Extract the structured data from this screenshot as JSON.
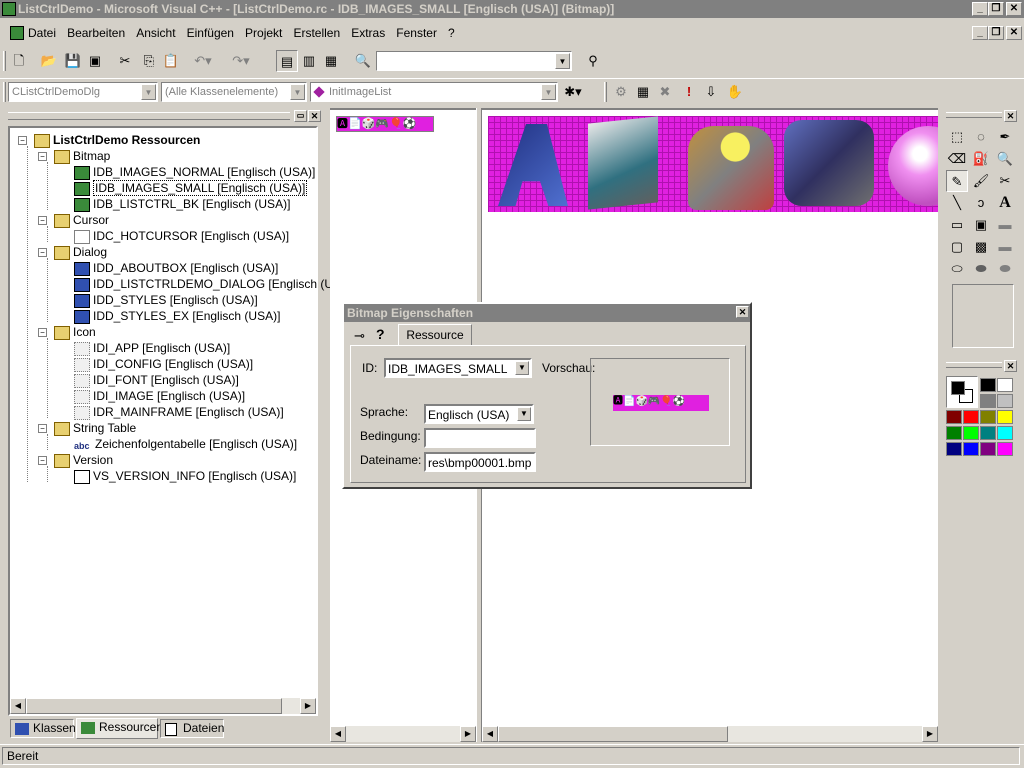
{
  "window": {
    "title": "ListCtrlDemo - Microsoft Visual C++ - [ListCtrlDemo.rc - IDB_IMAGES_SMALL [Englisch (USA)] (Bitmap)]"
  },
  "menu": [
    "Datei",
    "Bearbeiten",
    "Ansicht",
    "Einfügen",
    "Projekt",
    "Erstellen",
    "Extras",
    "Fenster",
    "?"
  ],
  "toolbar": {
    "find_combo_value": "",
    "class_combo": "CListCtrlDemoDlg",
    "members_combo": "(Alle Klassenelemente)",
    "function_combo": "InitImageList"
  },
  "tree": {
    "root": "ListCtrlDemo Ressourcen",
    "folders": {
      "bitmap": "Bitmap",
      "cursor": "Cursor",
      "dialog": "Dialog",
      "icon": "Icon",
      "string_table": "String Table",
      "version": "Version"
    },
    "bitmap_items": [
      "IDB_IMAGES_NORMAL [Englisch (USA)]",
      "IDB_IMAGES_SMALL [Englisch (USA)]",
      "IDB_LISTCTRL_BK [Englisch (USA)]"
    ],
    "cursor_items": [
      "IDC_HOTCURSOR [Englisch (USA)]"
    ],
    "dialog_items": [
      "IDD_ABOUTBOX [Englisch (USA)]",
      "IDD_LISTCTRLDEMO_DIALOG [Englisch (US",
      "IDD_STYLES [Englisch (USA)]",
      "IDD_STYLES_EX [Englisch (USA)]"
    ],
    "icon_items": [
      "IDI_APP [Englisch (USA)]",
      "IDI_CONFIG [Englisch (USA)]",
      "IDI_FONT [Englisch (USA)]",
      "IDI_IMAGE [Englisch (USA)]",
      "IDR_MAINFRAME [Englisch (USA)]"
    ],
    "string_items": [
      "Zeichenfolgentabelle [Englisch (USA)]"
    ],
    "version_items": [
      "VS_VERSION_INFO [Englisch (USA)]"
    ]
  },
  "workspace_tabs": [
    "Klassen",
    "Ressourcen",
    "Dateien"
  ],
  "properties": {
    "title": "Bitmap Eigenschaften",
    "tab": "Ressource",
    "id_label": "ID:",
    "id_value": "IDB_IMAGES_SMALL",
    "preview_label": "Vorschau:",
    "language_label": "Sprache:",
    "language_value": "Englisch (USA)",
    "condition_label": "Bedingung:",
    "condition_value": "",
    "filename_label": "Dateiname:",
    "filename_value": "res\\bmp00001.bmp"
  },
  "status": {
    "text": "Bereit"
  },
  "colors": {
    "title_inactive": "#808080",
    "face": "#d4d0c8",
    "bitmap_bg": "#e020e0"
  },
  "palette_colors": [
    "#000000",
    "#ffffff",
    "#808080",
    "#c0c0c0",
    "#800000",
    "#ff0000",
    "#808000",
    "#ffff00",
    "#008000",
    "#00ff00",
    "#008080",
    "#00ffff",
    "#000080",
    "#0000ff",
    "#800080",
    "#ff00ff"
  ]
}
